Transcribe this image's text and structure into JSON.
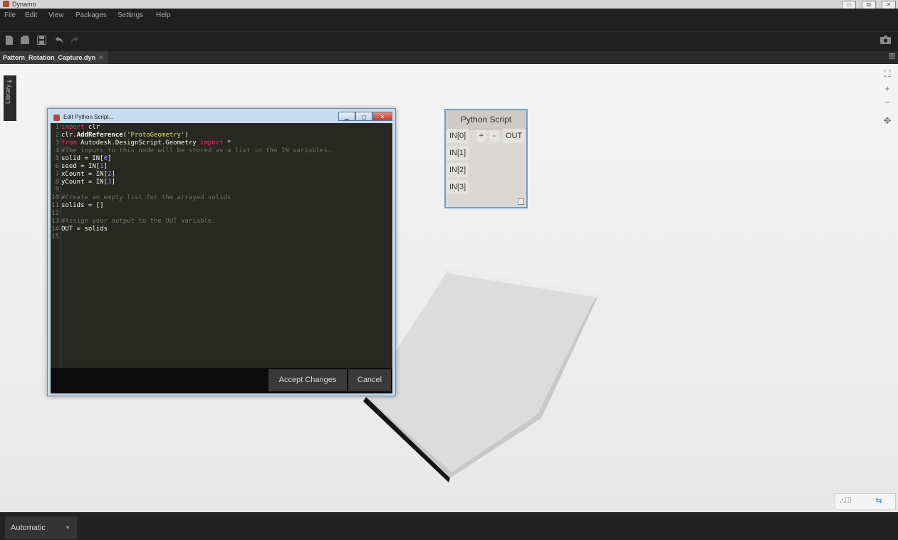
{
  "window": {
    "title": "Dynamo",
    "controls": [
      "▭",
      "⧉",
      "✕"
    ]
  },
  "menu": [
    "File",
    "Edit",
    "View",
    "Packages",
    "Settings",
    "Help"
  ],
  "toolbar": {
    "icons": [
      "new-file-icon",
      "open-file-icon",
      "save-icon",
      "undo-icon",
      "redo-icon",
      "camera-icon"
    ]
  },
  "tab": {
    "name": "Pattern_Rotation_Capture.dyn",
    "close": "✕"
  },
  "library": {
    "label": "Library"
  },
  "node": {
    "title": "Python Script",
    "inputs": [
      "IN[0]",
      "IN[1]",
      "IN[2]",
      "IN[3]"
    ],
    "add": "+",
    "remove": "-",
    "output": "OUT"
  },
  "editor": {
    "title": "Edit Python Script...",
    "lines": [
      {
        "n": "1",
        "parts": [
          {
            "c": "kw",
            "t": "import"
          },
          {
            "c": "tx",
            "t": " clr"
          }
        ]
      },
      {
        "n": "2",
        "parts": [
          {
            "c": "tx",
            "t": "clr."
          },
          {
            "c": "fn",
            "t": "AddReference"
          },
          {
            "c": "tx",
            "t": "("
          },
          {
            "c": "st",
            "t": "'ProtoGeometry'"
          },
          {
            "c": "tx",
            "t": ")"
          }
        ]
      },
      {
        "n": "3",
        "parts": [
          {
            "c": "kw",
            "t": "from"
          },
          {
            "c": "tx",
            "t": " Autodesk.DesignScript.Geometry "
          },
          {
            "c": "kw",
            "t": "import"
          },
          {
            "c": "tx",
            "t": " *"
          }
        ]
      },
      {
        "n": "4",
        "parts": [
          {
            "c": "cm",
            "t": "#The inputs to this node will be stored as a list in the IN variables."
          }
        ]
      },
      {
        "n": "5",
        "parts": [
          {
            "c": "tx",
            "t": "solid = IN["
          },
          {
            "c": "nm",
            "t": "0"
          },
          {
            "c": "tx",
            "t": "]"
          }
        ]
      },
      {
        "n": "6",
        "parts": [
          {
            "c": "tx",
            "t": "seed = IN["
          },
          {
            "c": "nm",
            "t": "1"
          },
          {
            "c": "tx",
            "t": "]"
          }
        ]
      },
      {
        "n": "7",
        "parts": [
          {
            "c": "tx",
            "t": "xCount = IN["
          },
          {
            "c": "nm",
            "t": "2"
          },
          {
            "c": "tx",
            "t": "]"
          }
        ]
      },
      {
        "n": "8",
        "parts": [
          {
            "c": "tx",
            "t": "yCount = IN["
          },
          {
            "c": "nm",
            "t": "3"
          },
          {
            "c": "tx",
            "t": "]"
          }
        ]
      },
      {
        "n": "9",
        "parts": []
      },
      {
        "n": "10",
        "parts": [
          {
            "c": "cm",
            "t": "#Create an empty list for the arrayed solids"
          }
        ]
      },
      {
        "n": "11",
        "parts": [
          {
            "c": "tx",
            "t": "solids = []"
          }
        ]
      },
      {
        "n": "12",
        "parts": []
      },
      {
        "n": "13",
        "parts": [
          {
            "c": "cm",
            "t": "#Assign your output to the OUT variable."
          }
        ]
      },
      {
        "n": "14",
        "parts": [
          {
            "c": "tx",
            "t": "OUT = solids"
          }
        ]
      },
      {
        "n": "15",
        "parts": []
      }
    ],
    "accept": "Accept Changes",
    "cancel": "Cancel"
  },
  "zoom": {
    "fit": "⛶",
    "in": "+",
    "out": "−",
    "pan": "✥"
  },
  "run": {
    "mode": "Automatic",
    "arrow": "▾"
  },
  "view_toggle": {
    "geometry": "⛬◫",
    "graph": "⇆"
  }
}
